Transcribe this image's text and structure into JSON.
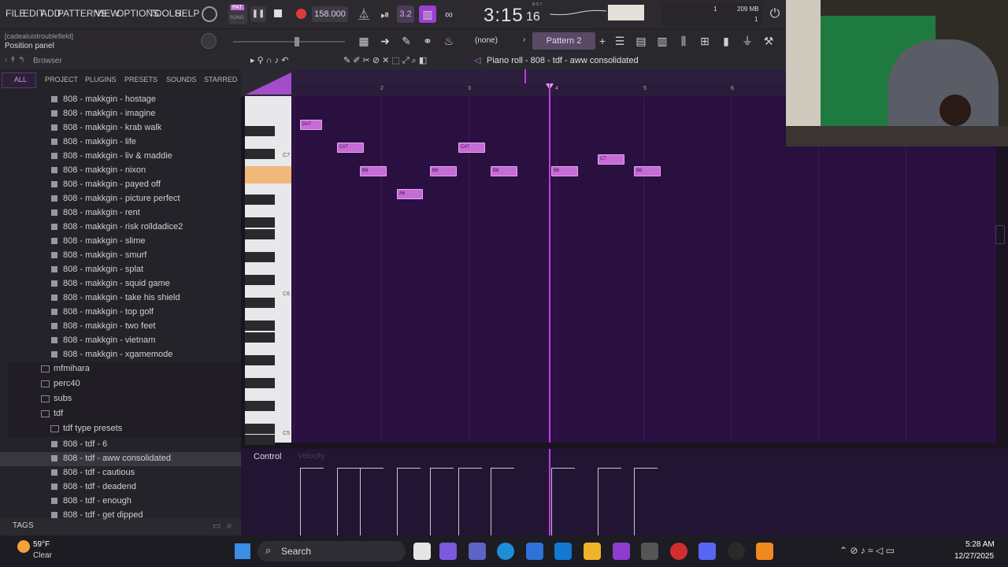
{
  "menu": [
    "FILE",
    "EDIT",
    "ADD",
    "PATTERNS",
    "VIEW",
    "OPTIONS",
    "TOOLS",
    "HELP"
  ],
  "transport": {
    "pat_label": "PAT",
    "song_label": "SONG",
    "tempo": "158.000",
    "time": "3:15",
    "time_ticks": "16",
    "time_label": "B:S:T",
    "cpu_value": "1",
    "ram": "209 MB",
    "voices": "1"
  },
  "hint": {
    "line1": "[cadealuistroublefield]",
    "line2": "Position panel"
  },
  "toolbar2": {
    "pattern_none": "(none)",
    "pattern_name": "Pattern 2"
  },
  "browser": {
    "title": "Browser",
    "tabs": [
      "ALL",
      "PROJECT",
      "PLUGINS",
      "PRESETS",
      "SOUNDS",
      "STARRED"
    ],
    "files_top": [
      "808 - makkgin - hostage",
      "808 - makkgin - imagine",
      "808 - makkgin - krab walk",
      "808 - makkgin - life",
      "808 - makkgin - liv & maddie",
      "808 - makkgin - nixon",
      "808 - makkgin - payed off",
      "808 - makkgin - picture perfect",
      "808 - makkgin - rent",
      "808 - makkgin - risk rolldadice2",
      "808 - makkgin - slime",
      "808 - makkgin - smurf",
      "808 - makkgin - splat",
      "808 - makkgin - squid game",
      "808 - makkgin - take his shield",
      "808 - makkgin - top golf",
      "808 - makkgin - two feet",
      "808 - makkgin - vietnam",
      "808 - makkgin - xgamemode"
    ],
    "folders": [
      "mfmihara",
      "perc40",
      "subs",
      "tdf",
      "tdf type presets"
    ],
    "files_bottom": [
      "808 - tdf - 6",
      "808 - tdf - aww consolidated",
      "808 - tdf - cautious",
      "808 - tdf - deadend",
      "808 - tdf - enough",
      "808 - tdf - get dipped"
    ],
    "tags_label": "TAGS"
  },
  "piano_roll": {
    "title": "Piano roll - 808 - tdf - aww consolidated",
    "ruler": [
      "2",
      "3",
      "4",
      "5",
      "6"
    ],
    "key_labels": [
      "C7",
      "C6",
      "C5"
    ],
    "notes": [
      {
        "label": "D#7"
      },
      {
        "label": "C#7"
      },
      {
        "label": "C#7"
      },
      {
        "label": "C7"
      },
      {
        "label": "B6"
      },
      {
        "label": "B6"
      },
      {
        "label": "B6"
      },
      {
        "label": "B6"
      },
      {
        "label": "B6"
      },
      {
        "label": "A6"
      }
    ],
    "control_label": "Control",
    "control_param": "Velocity"
  },
  "taskbar": {
    "temp": "59°F",
    "weather": "Clear",
    "search": "Search",
    "time": "5:28 AM",
    "date": "12/27/2025"
  },
  "colors": {
    "accent": "#c33be0",
    "note": "#c56cd6",
    "grid": "#2a1040"
  }
}
